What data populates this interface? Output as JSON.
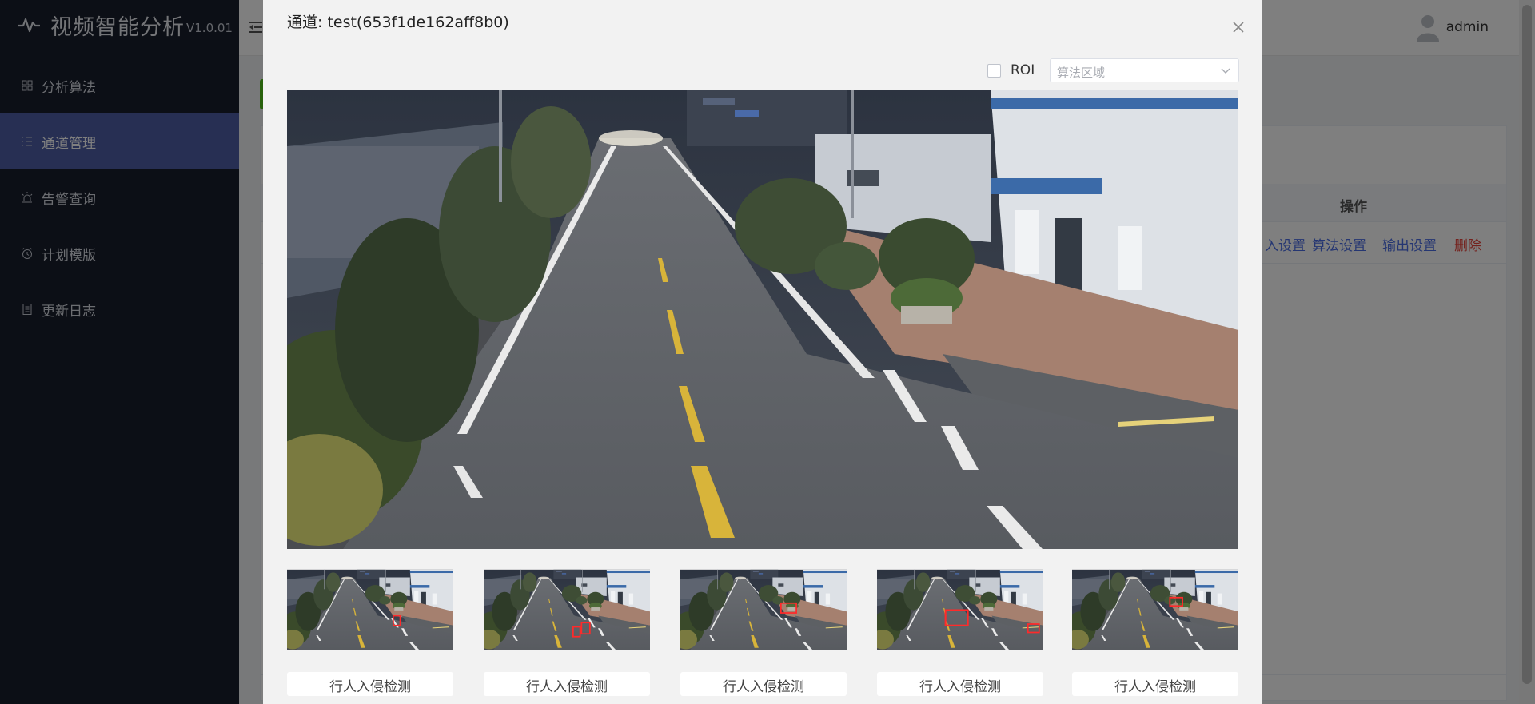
{
  "app": {
    "title": "视频智能分析",
    "version": "V1.0.01"
  },
  "sidebar": {
    "items": [
      {
        "label": "分析算法",
        "icon": "grid-icon",
        "active": false
      },
      {
        "label": "通道管理",
        "icon": "list-icon",
        "active": true
      },
      {
        "label": "告警查询",
        "icon": "alarm-light-icon",
        "active": false
      },
      {
        "label": "计划模版",
        "icon": "clock-icon",
        "active": false
      },
      {
        "label": "更新日志",
        "icon": "document-icon",
        "active": false
      }
    ]
  },
  "header": {
    "username": "admin"
  },
  "table": {
    "ops_header": "操作",
    "ops": [
      "入设置",
      "算法设置",
      "输出设置",
      "删除"
    ]
  },
  "modal": {
    "title": "通道: test(653f1de162aff8b0)",
    "roi_label": "ROI",
    "select_placeholder": "算法区域",
    "thumbnails": [
      {
        "label": "行人入侵检测"
      },
      {
        "label": "行人入侵检测"
      },
      {
        "label": "行人入侵检测"
      },
      {
        "label": "行人入侵检测"
      },
      {
        "label": "行人入侵检测"
      }
    ]
  },
  "colors": {
    "sidebar_bg": "#191e2c",
    "active_bg": "#4f5fa6",
    "link": "#4a6de5",
    "danger": "#e8453c",
    "alert_box": "#ff2a2a"
  }
}
